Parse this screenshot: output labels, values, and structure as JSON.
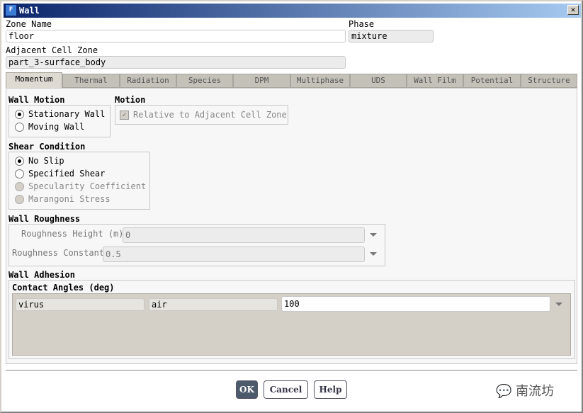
{
  "window": {
    "title": "Wall",
    "logo": "F",
    "close": "✕"
  },
  "zone_name": {
    "label": "Zone Name",
    "value": "floor"
  },
  "phase": {
    "label": "Phase",
    "value": "mixture"
  },
  "adjacent": {
    "label": "Adjacent Cell Zone",
    "value": "part_3-surface_body"
  },
  "tabs": [
    "Momentum",
    "Thermal",
    "Radiation",
    "Species",
    "DPM",
    "Multiphase",
    "UDS",
    "Wall Film",
    "Potential",
    "Structure"
  ],
  "wall_motion": {
    "title": "Wall Motion",
    "options": [
      "Stationary Wall",
      "Moving Wall"
    ],
    "selected": 0
  },
  "motion": {
    "title": "Motion",
    "checkbox": "Relative to Adjacent Cell Zone",
    "checked": true
  },
  "shear": {
    "title": "Shear Condition",
    "options": [
      "No Slip",
      "Specified Shear",
      "Specularity Coefficient",
      "Marangoni Stress"
    ],
    "selected": 0
  },
  "roughness": {
    "title": "Wall Roughness",
    "height_label": "Roughness Height (m)",
    "height_value": "0",
    "constant_label": "Roughness Constant",
    "constant_value": "0.5"
  },
  "adhesion": {
    "title": "Wall Adhesion",
    "subtitle": "Contact Angles (deg)",
    "phase1": "virus",
    "phase2": "air",
    "value": "100"
  },
  "buttons": {
    "ok": "OK",
    "cancel": "Cancel",
    "help": "Help"
  },
  "watermark": "南流坊"
}
